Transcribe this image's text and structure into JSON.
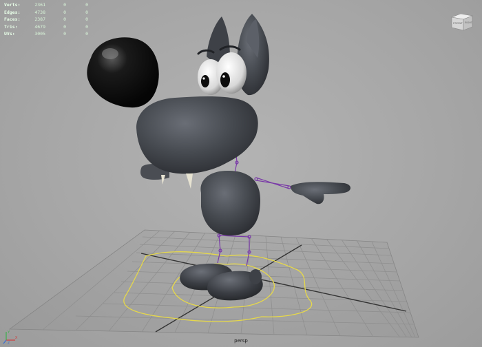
{
  "viewport": {
    "camera_name": "persp",
    "hud": {
      "rows": [
        {
          "label": "Verts:",
          "value": "2361",
          "sel": "0",
          "tri": "0"
        },
        {
          "label": "Edges:",
          "value": "4738",
          "sel": "0",
          "tri": "0"
        },
        {
          "label": "Faces:",
          "value": "2387",
          "sel": "0",
          "tri": "0"
        },
        {
          "label": "Tris:",
          "value": "4679",
          "sel": "0",
          "tri": "0"
        },
        {
          "label": "UVs:",
          "value": "3005",
          "sel": "0",
          "tri": "0"
        }
      ]
    },
    "viewcube": {
      "front_label": "FRONT",
      "right_label": "RIGHT"
    },
    "axis": {
      "x": "X",
      "y": "Y",
      "z": "Z"
    },
    "colors": {
      "background": "#a9a9a9",
      "grid": "#8f8f8f",
      "character": "#4a4d53",
      "joint": "#7a3aa8",
      "nurbs_curve": "#e6d84a",
      "hud_text": "#d9f5d9"
    }
  }
}
